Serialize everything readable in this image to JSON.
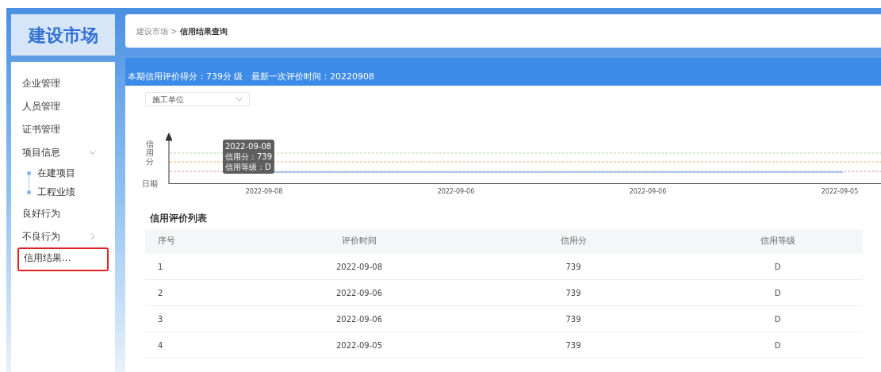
{
  "logo": "建设市场",
  "sidebar": {
    "items": [
      {
        "label": "企业管理",
        "selected": false
      },
      {
        "label": "人员管理",
        "selected": false
      },
      {
        "label": "证书管理",
        "selected": false
      },
      {
        "label": "项目信息",
        "selected": false,
        "expanded": true,
        "children": [
          {
            "label": "在建项目",
            "selected": false
          },
          {
            "label": "工程业绩",
            "selected": false
          }
        ]
      },
      {
        "label": "良好行为",
        "selected": false
      },
      {
        "label": "不良行为",
        "selected": false,
        "expanded": false
      },
      {
        "label": "信用结果...",
        "selected": true
      }
    ]
  },
  "breadcrumb": {
    "parent": "建设市场 >",
    "current": "信用结果查询"
  },
  "summary": "本期信用评价得分：739分 级   最新一次评价时间：20220908",
  "dropdown": {
    "value": "施工单位"
  },
  "trend_chart": {
    "ylabel": "信用分",
    "xlabel": "日期",
    "x_labels": [
      "2022-09-08",
      "2022-09-06",
      "2022-09-06",
      "2022-09-05"
    ],
    "tooltip": [
      "2022-09-08",
      "信用分：739",
      "信用等级：D"
    ]
  },
  "table": {
    "title": "信用评价列表",
    "columns": [
      "序号",
      "评价时间",
      "信用分",
      "信用等级"
    ],
    "rows": [
      [
        "1",
        "2022-09-08",
        "739",
        "D"
      ],
      [
        "2",
        "2022-09-06",
        "739",
        "D"
      ],
      [
        "3",
        "2022-09-06",
        "739",
        "D"
      ],
      [
        "4",
        "2022-09-05",
        "739",
        "D"
      ]
    ]
  }
}
